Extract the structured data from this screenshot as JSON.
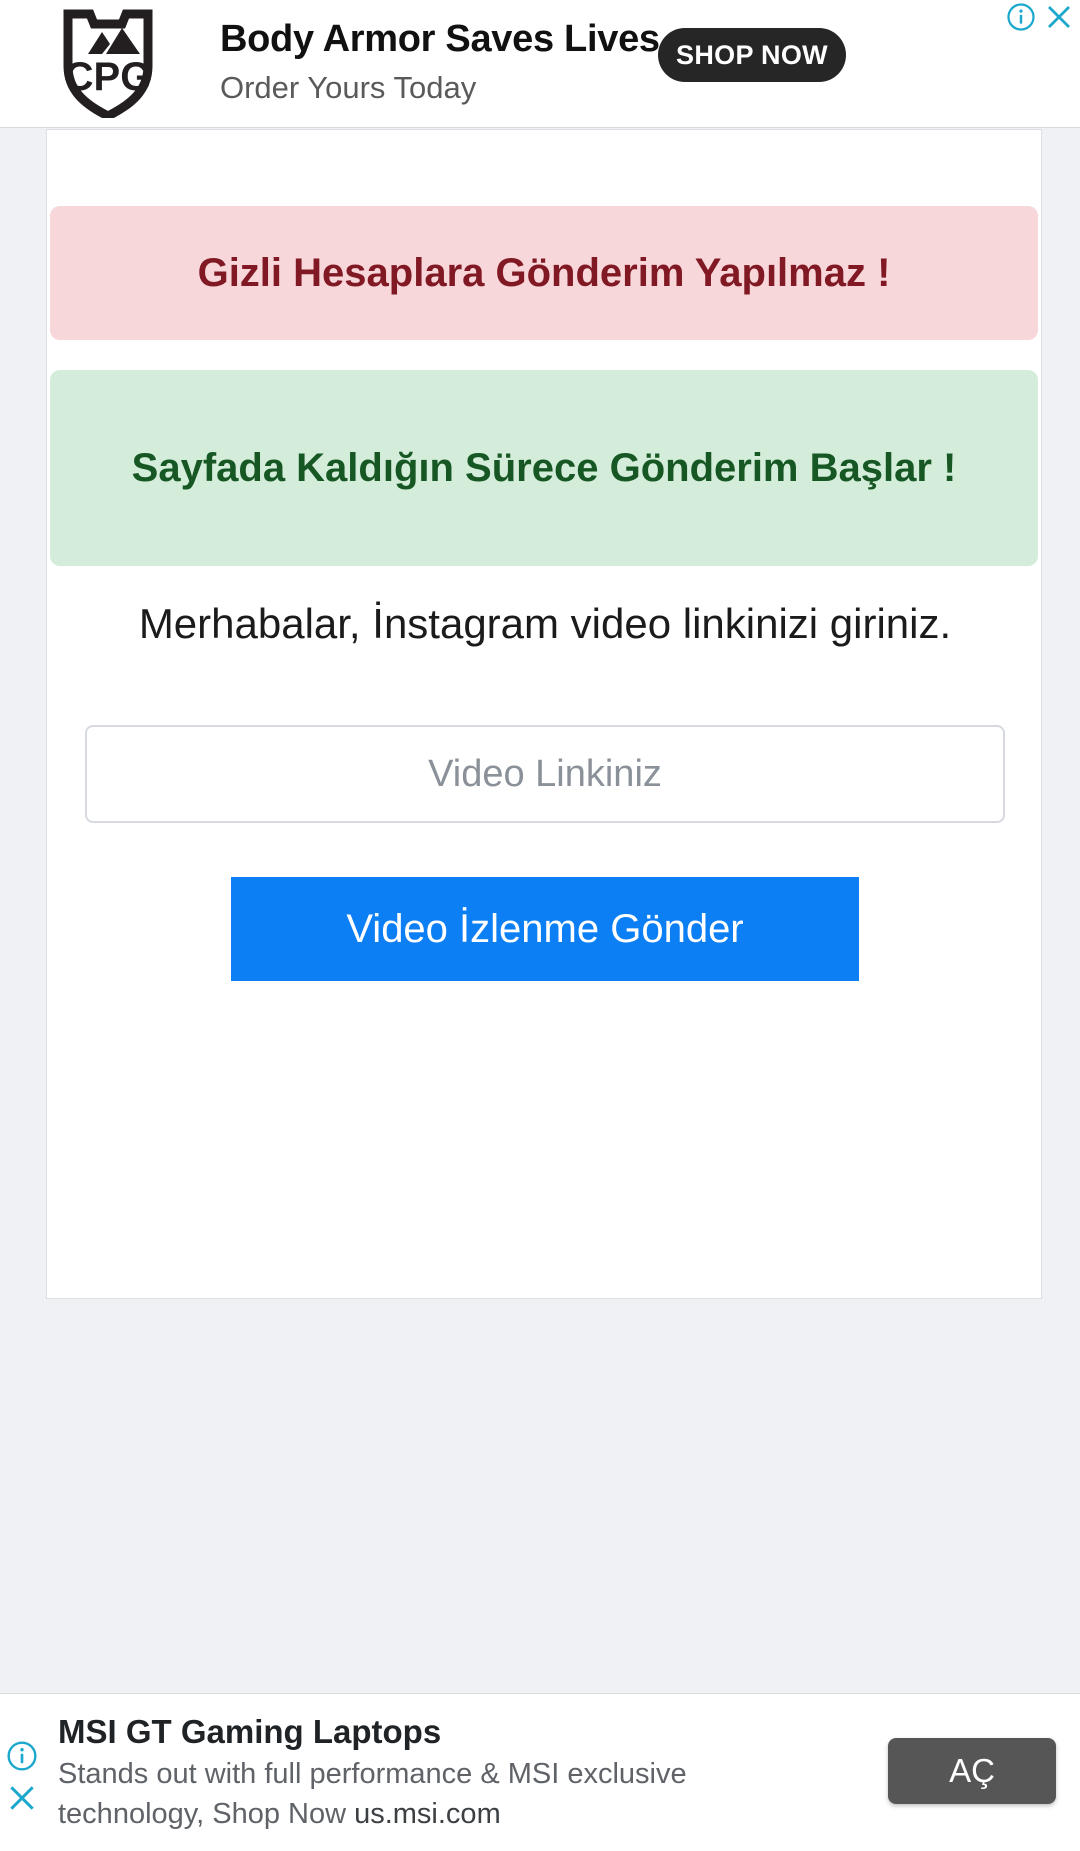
{
  "top_ad": {
    "logo_text": "CPG",
    "headline": "Body Armor Saves Lives",
    "subline": "Order Yours Today",
    "cta_label": "SHOP NOW",
    "info_icon": "info-circle-icon",
    "close_icon": "close-x-icon",
    "icon_color": "#1BA8CC"
  },
  "card": {
    "alert_danger": "Gizli Hesaplara Gönderim Yapılmaz !",
    "alert_danger_bg": "#f8d7da",
    "alert_danger_color": "#801924",
    "alert_success": "Sayfada Kaldığın Sürece Gönderim Başlar !",
    "alert_success_bg": "#d4edda",
    "alert_success_color": "#165724",
    "heading": "Merhabalar, İnstagram video linkinizi giriniz.",
    "input_value": "",
    "input_placeholder": "Video Linkiniz",
    "submit_label": "Video İzlenme Gönder",
    "submit_bg": "#0d7ff5"
  },
  "bottom_ad": {
    "title": "MSI GT Gaming Laptops",
    "desc_line1": "Stands out with full performance & MSI exclusive",
    "desc_line2_pre": "technology, Shop Now ",
    "desc_line2_url": "us.msi.com",
    "cta_label": "AÇ",
    "cta_bg": "#565656",
    "info_icon": "info-circle-icon",
    "close_icon": "close-x-icon",
    "icon_color": "#1BA8CC"
  }
}
